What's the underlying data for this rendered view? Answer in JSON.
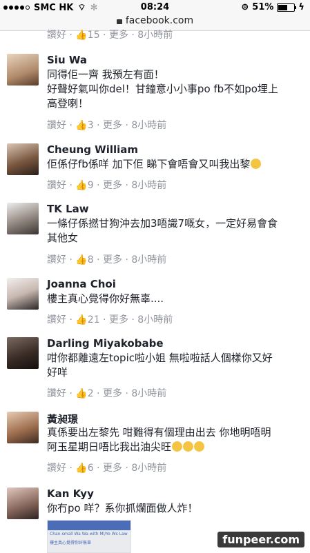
{
  "status": {
    "carrier": "SMC HK",
    "time": "08:24",
    "battery": "51%",
    "battery_fraction": 0.51
  },
  "url": {
    "host": "facebook.com"
  },
  "top_actions": {
    "text": "讚好 · 👍15 · 更多 · 8小時前"
  },
  "comments": [
    {
      "name": "Siu Wa",
      "lines": [
        "同得佢一齊 我預左有面！",
        "好聲好氣叫你del！甘鐘意小小事po fb不如po埋上",
        "高登喇！"
      ],
      "actions": "讚好 · 👍3 · 更多 · 8小時前"
    },
    {
      "name": "Cheung William",
      "lines": [
        "佢係仔fb係咩 加下佢 睇下會唔會又叫我出黎"
      ],
      "actions": "讚好 · 👍9 · 更多 · 8小時前"
    },
    {
      "name": "TK Law",
      "lines": [
        "一條仔係撚甘狗沖去加3唔識7嘅女，一定好易會食",
        "其他女"
      ],
      "actions": "讚好 · 👍8 · 更多 · 8小時前"
    },
    {
      "name": "Joanna Choi",
      "lines": [
        "樓主真心覺得你好無辜...."
      ],
      "actions": "讚好 · 👍21 · 更多 · 8小時前"
    },
    {
      "name": "Darling Miyakobabe",
      "lines": [
        "咁你都離遠左topic啦小姐 無啦啦話人個樣你又好",
        "好咩"
      ],
      "actions": "讚好 · 👍2 · 更多 · 8小時前"
    },
    {
      "name": "黃昶璟",
      "lines": [
        "真係要出左黎先 咁難得有個理由出去 你地明唔明",
        "阿玉星期日唔比我出油尖旺"
      ],
      "actions": "讚好 · 👍6 · 更多 · 8小時前"
    },
    {
      "name": "Kan Kyy",
      "lines": [
        "你冇po 咩？系你抓爛面做人炸！"
      ],
      "actions": ""
    }
  ],
  "thumb": {
    "line1": "Chan-small Wa Wa with Ml/Yo Ws Law",
    "line2": "樓主真心覺得你好無辜"
  },
  "watermark": "funpeer.com"
}
